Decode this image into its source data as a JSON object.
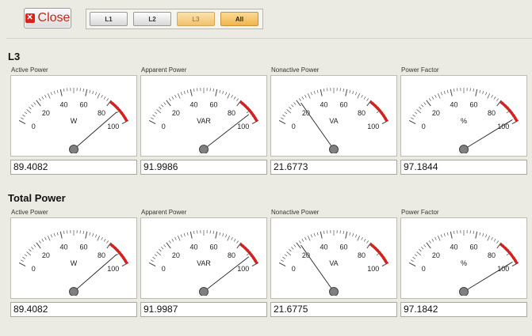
{
  "toolbar": {
    "close_label": "Close",
    "close_icon": "close-x-icon",
    "tabs": [
      {
        "label": "L1",
        "state": "normal"
      },
      {
        "label": "L2",
        "state": "normal"
      },
      {
        "label": "L3",
        "state": "selected"
      },
      {
        "label": "All",
        "state": "highlighted"
      }
    ]
  },
  "sections": [
    {
      "title": "L3",
      "gauges": [
        {
          "label": "Active Power",
          "unit": "W",
          "value": "89.4082",
          "reading": 89.4082
        },
        {
          "label": "Apparent Power",
          "unit": "VAR",
          "value": "91.9986",
          "reading": 91.9986
        },
        {
          "label": "Nonactive Power",
          "unit": "VA",
          "value": "21.6773",
          "reading": 21.6773
        },
        {
          "label": "Power Factor",
          "unit": "%",
          "value": "97.1844",
          "reading": 97.1844
        }
      ]
    },
    {
      "title": "Total Power",
      "gauges": [
        {
          "label": "Active Power",
          "unit": "W",
          "value": "89.4082",
          "reading": 89.4082
        },
        {
          "label": "Apparent Power",
          "unit": "VAR",
          "value": "91.9987",
          "reading": 91.9987
        },
        {
          "label": "Nonactive Power",
          "unit": "VA",
          "value": "21.6775",
          "reading": 21.6775
        },
        {
          "label": "Power Factor",
          "unit": "%",
          "value": "97.1842",
          "reading": 97.1842
        }
      ]
    }
  ],
  "gauge_scale": {
    "min": 0,
    "max": 100,
    "tick_labels": [
      "0",
      "20",
      "40",
      "60",
      "80",
      "100"
    ],
    "red_zone_start": 80,
    "red_zone_color": "#d62020",
    "needle_color": "#333333",
    "hub_color": "#808080"
  }
}
